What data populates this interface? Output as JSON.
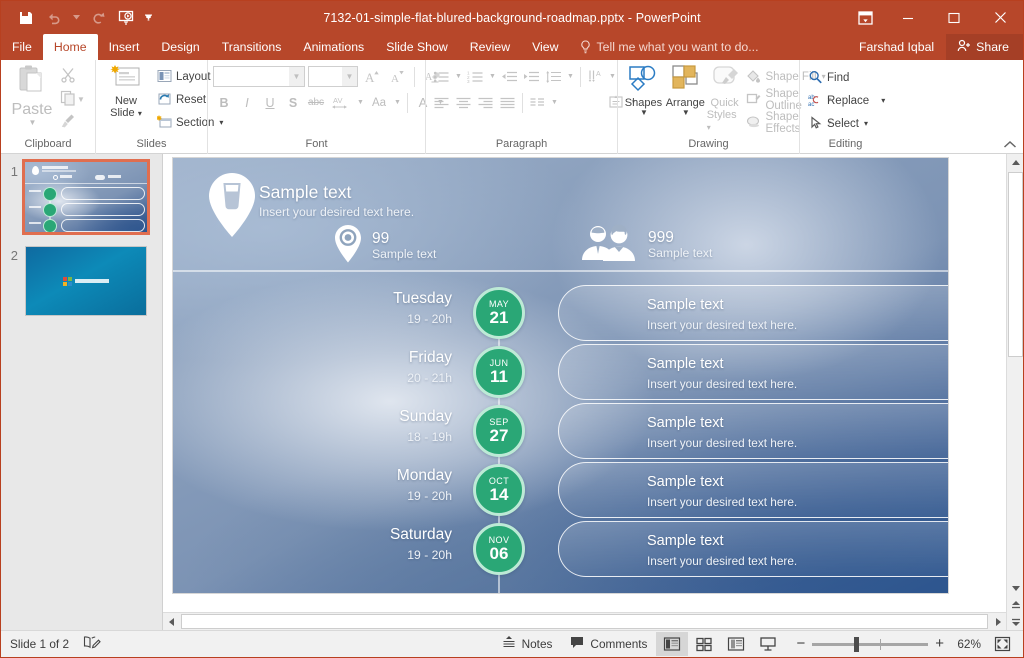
{
  "window": {
    "title": "7132-01-simple-flat-blured-background-roadmap.pptx - PowerPoint",
    "quick_access": [
      {
        "name": "save-icon",
        "label": "Save"
      },
      {
        "name": "undo-icon",
        "label": "Undo"
      },
      {
        "name": "redo-icon",
        "label": "Redo"
      },
      {
        "name": "start-presentation-icon",
        "label": "Start From Beginning"
      },
      {
        "name": "customize-qat-icon",
        "label": "Customize Quick Access Toolbar"
      }
    ],
    "controls": {
      "ribbon_display": "Ribbon Display Options",
      "minimize": "Minimize",
      "maximize": "Maximize",
      "close": "Close"
    },
    "accent_color": "#b7472a",
    "share_bg": "#a53f26"
  },
  "tabs": [
    {
      "label": "File",
      "active": false
    },
    {
      "label": "Home",
      "active": true
    },
    {
      "label": "Insert",
      "active": false
    },
    {
      "label": "Design",
      "active": false
    },
    {
      "label": "Transitions",
      "active": false
    },
    {
      "label": "Animations",
      "active": false
    },
    {
      "label": "Slide Show",
      "active": false
    },
    {
      "label": "Review",
      "active": false
    },
    {
      "label": "View",
      "active": false
    }
  ],
  "tellme": {
    "label": "Tell me what you want to do..."
  },
  "account": {
    "user": "Farshad Iqbal",
    "share": "Share"
  },
  "ribbon": {
    "clipboard": {
      "label": "Clipboard",
      "paste": "Paste",
      "cut": "Cut",
      "copy": "Copy",
      "format_painter": "Format Painter"
    },
    "slides": {
      "label": "Slides",
      "new_slide_line1": "New",
      "new_slide_line2": "Slide",
      "layout": "Layout",
      "reset": "Reset",
      "section": "Section"
    },
    "font": {
      "label": "Font",
      "font_name": "",
      "font_size": "",
      "grow": "Increase Font Size",
      "shrink": "Decrease Font Size",
      "clear_format": "Clear All Formatting",
      "bold": "B",
      "italic": "I",
      "underline": "U",
      "shadow": "S",
      "strikethrough": "abc",
      "spacing": "AV",
      "change_case": "Aa",
      "font_color": "A"
    },
    "paragraph": {
      "label": "Paragraph",
      "bullets": "Bullets",
      "numbering": "Numbering",
      "decrease_indent": "Decrease List Level",
      "increase_indent": "Increase List Level",
      "line_spacing": "Line Spacing",
      "text_direction": "Text Direction",
      "align_text": "Align Text",
      "convert_smartart": "Convert to SmartArt",
      "align_left": "Align Left",
      "center": "Center",
      "align_right": "Align Right",
      "justify": "Justify",
      "columns": "Columns"
    },
    "drawing": {
      "label": "Drawing",
      "shapes": "Shapes",
      "arrange": "Arrange",
      "quick_styles_line1": "Quick",
      "quick_styles_line2": "Styles",
      "shape_fill": "Shape Fill",
      "shape_outline": "Shape Outline",
      "shape_effects": "Shape Effects"
    },
    "editing": {
      "label": "Editing",
      "find": "Find",
      "replace": "Replace",
      "select": "Select"
    },
    "collapse": "Collapse the Ribbon"
  },
  "thumbnails": [
    {
      "number": "1",
      "selected": true
    },
    {
      "number": "2",
      "selected": false
    }
  ],
  "slide": {
    "header": {
      "title": "Sample text",
      "subtitle": "Insert your desired text here.",
      "stats": [
        {
          "icon": "location-pin-icon",
          "number": "99",
          "caption": "Sample text"
        },
        {
          "icon": "two-people-icon",
          "number": "999",
          "caption": "Sample text"
        }
      ]
    },
    "milestone_circle_color": "#2aa776",
    "milestone_ring_color": "#bdead6",
    "rows": [
      {
        "day": "Tuesday",
        "time": "19 - 20h",
        "month": "MAY",
        "date": "21",
        "title": "Sample text",
        "desc": "Insert your desired text here."
      },
      {
        "day": "Friday",
        "time": "20 - 21h",
        "month": "JUN",
        "date": "11",
        "title": "Sample text",
        "desc": "Insert your desired text here."
      },
      {
        "day": "Sunday",
        "time": "18 - 19h",
        "month": "SEP",
        "date": "27",
        "title": "Sample text",
        "desc": "Insert your desired text here."
      },
      {
        "day": "Monday",
        "time": "19 - 20h",
        "month": "OCT",
        "date": "14",
        "title": "Sample text",
        "desc": "Insert your desired text here."
      },
      {
        "day": "Saturday",
        "time": "19 - 20h",
        "month": "NOV",
        "date": "06",
        "title": "Sample text",
        "desc": "Insert your desired text here."
      }
    ]
  },
  "statusbar": {
    "slide_count": "Slide 1 of 2",
    "accessibility": "Accessibility Checker",
    "notes": "Notes",
    "comments": "Comments",
    "views": [
      {
        "name": "normal-view",
        "active": true
      },
      {
        "name": "slide-sorter-view",
        "active": false
      },
      {
        "name": "reading-view",
        "active": false
      },
      {
        "name": "slide-show-view",
        "active": false
      }
    ],
    "zoom_out": "−",
    "zoom_in": "+",
    "zoom_level": "62%",
    "fit_slide": "Fit slide to current window"
  }
}
